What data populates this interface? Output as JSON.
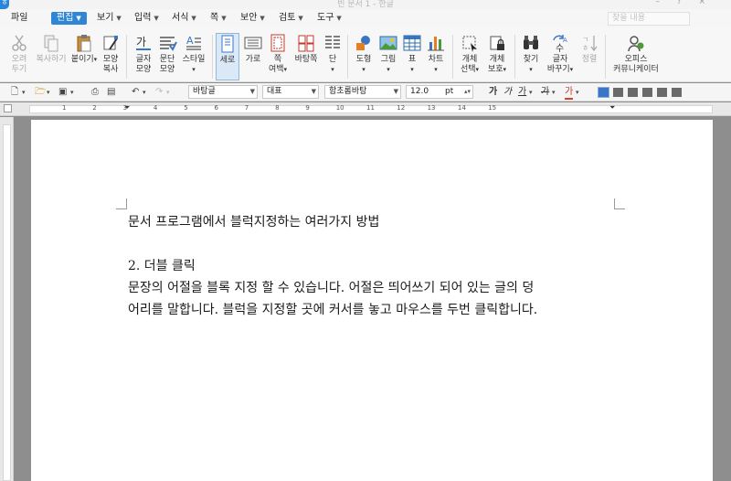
{
  "window": {
    "title": "빈 문서 1 - 한글",
    "controls": "– ? ×"
  },
  "menubar": {
    "file": "파일",
    "items": [
      "편집",
      "보기",
      "입력",
      "서식",
      "쪽",
      "보안",
      "검토",
      "도구"
    ],
    "search_placeholder": "찾을 내용"
  },
  "ribbon": {
    "cut": [
      "오려",
      "두기"
    ],
    "copy": "복사하기",
    "paste": "붙이기",
    "format_copy": [
      "모양",
      "복사"
    ],
    "char_shape": [
      "글자",
      "모양"
    ],
    "para_shape": [
      "문단",
      "모양"
    ],
    "style": "스타일",
    "vertical": "세로",
    "horizontal": "가로",
    "page_margin": [
      "쪽",
      "여백"
    ],
    "background_page": "바탕쪽",
    "column": "단",
    "shape": "도형",
    "picture": "그림",
    "table": "표",
    "chart": "차트",
    "object_select": [
      "개체",
      "선택"
    ],
    "object_protect": [
      "개체",
      "보호"
    ],
    "find": "찾기",
    "replace": [
      "글자",
      "바꾸기"
    ],
    "sort": "정렬",
    "office_communicator": [
      "오피스",
      "커뮤니케이터"
    ]
  },
  "toolbar2": {
    "style_name": "바탕글",
    "language": "대표",
    "font_name": "함초롬바탕",
    "font_size": "12.0",
    "font_unit": "pt",
    "bold": "가",
    "italic": "가",
    "underline": "가",
    "strike": "가",
    "color": "가"
  },
  "ruler": {
    "numbers": [
      "1",
      "2",
      "3",
      "4",
      "5",
      "6",
      "7",
      "8",
      "9",
      "10",
      "11",
      "12",
      "13",
      "14",
      "15"
    ]
  },
  "document": {
    "title": "문서 프로그램에서 블럭지정하는 여러가지 방법",
    "heading": "2. 더블 클릭",
    "body_line1": "문장의 어절을 블록 지정 할 수 있습니다. 어절은 띄어쓰기 되어 있는 글의 덩",
    "body_line2": "어리를 말합니다. 블럭을 지정할 곳에 커서를 놓고 마우스를 두번 클릭합니다."
  },
  "colors": {
    "accent": "#2f86d4",
    "page": "#ffffff",
    "workspace": "#8e8e8e"
  }
}
